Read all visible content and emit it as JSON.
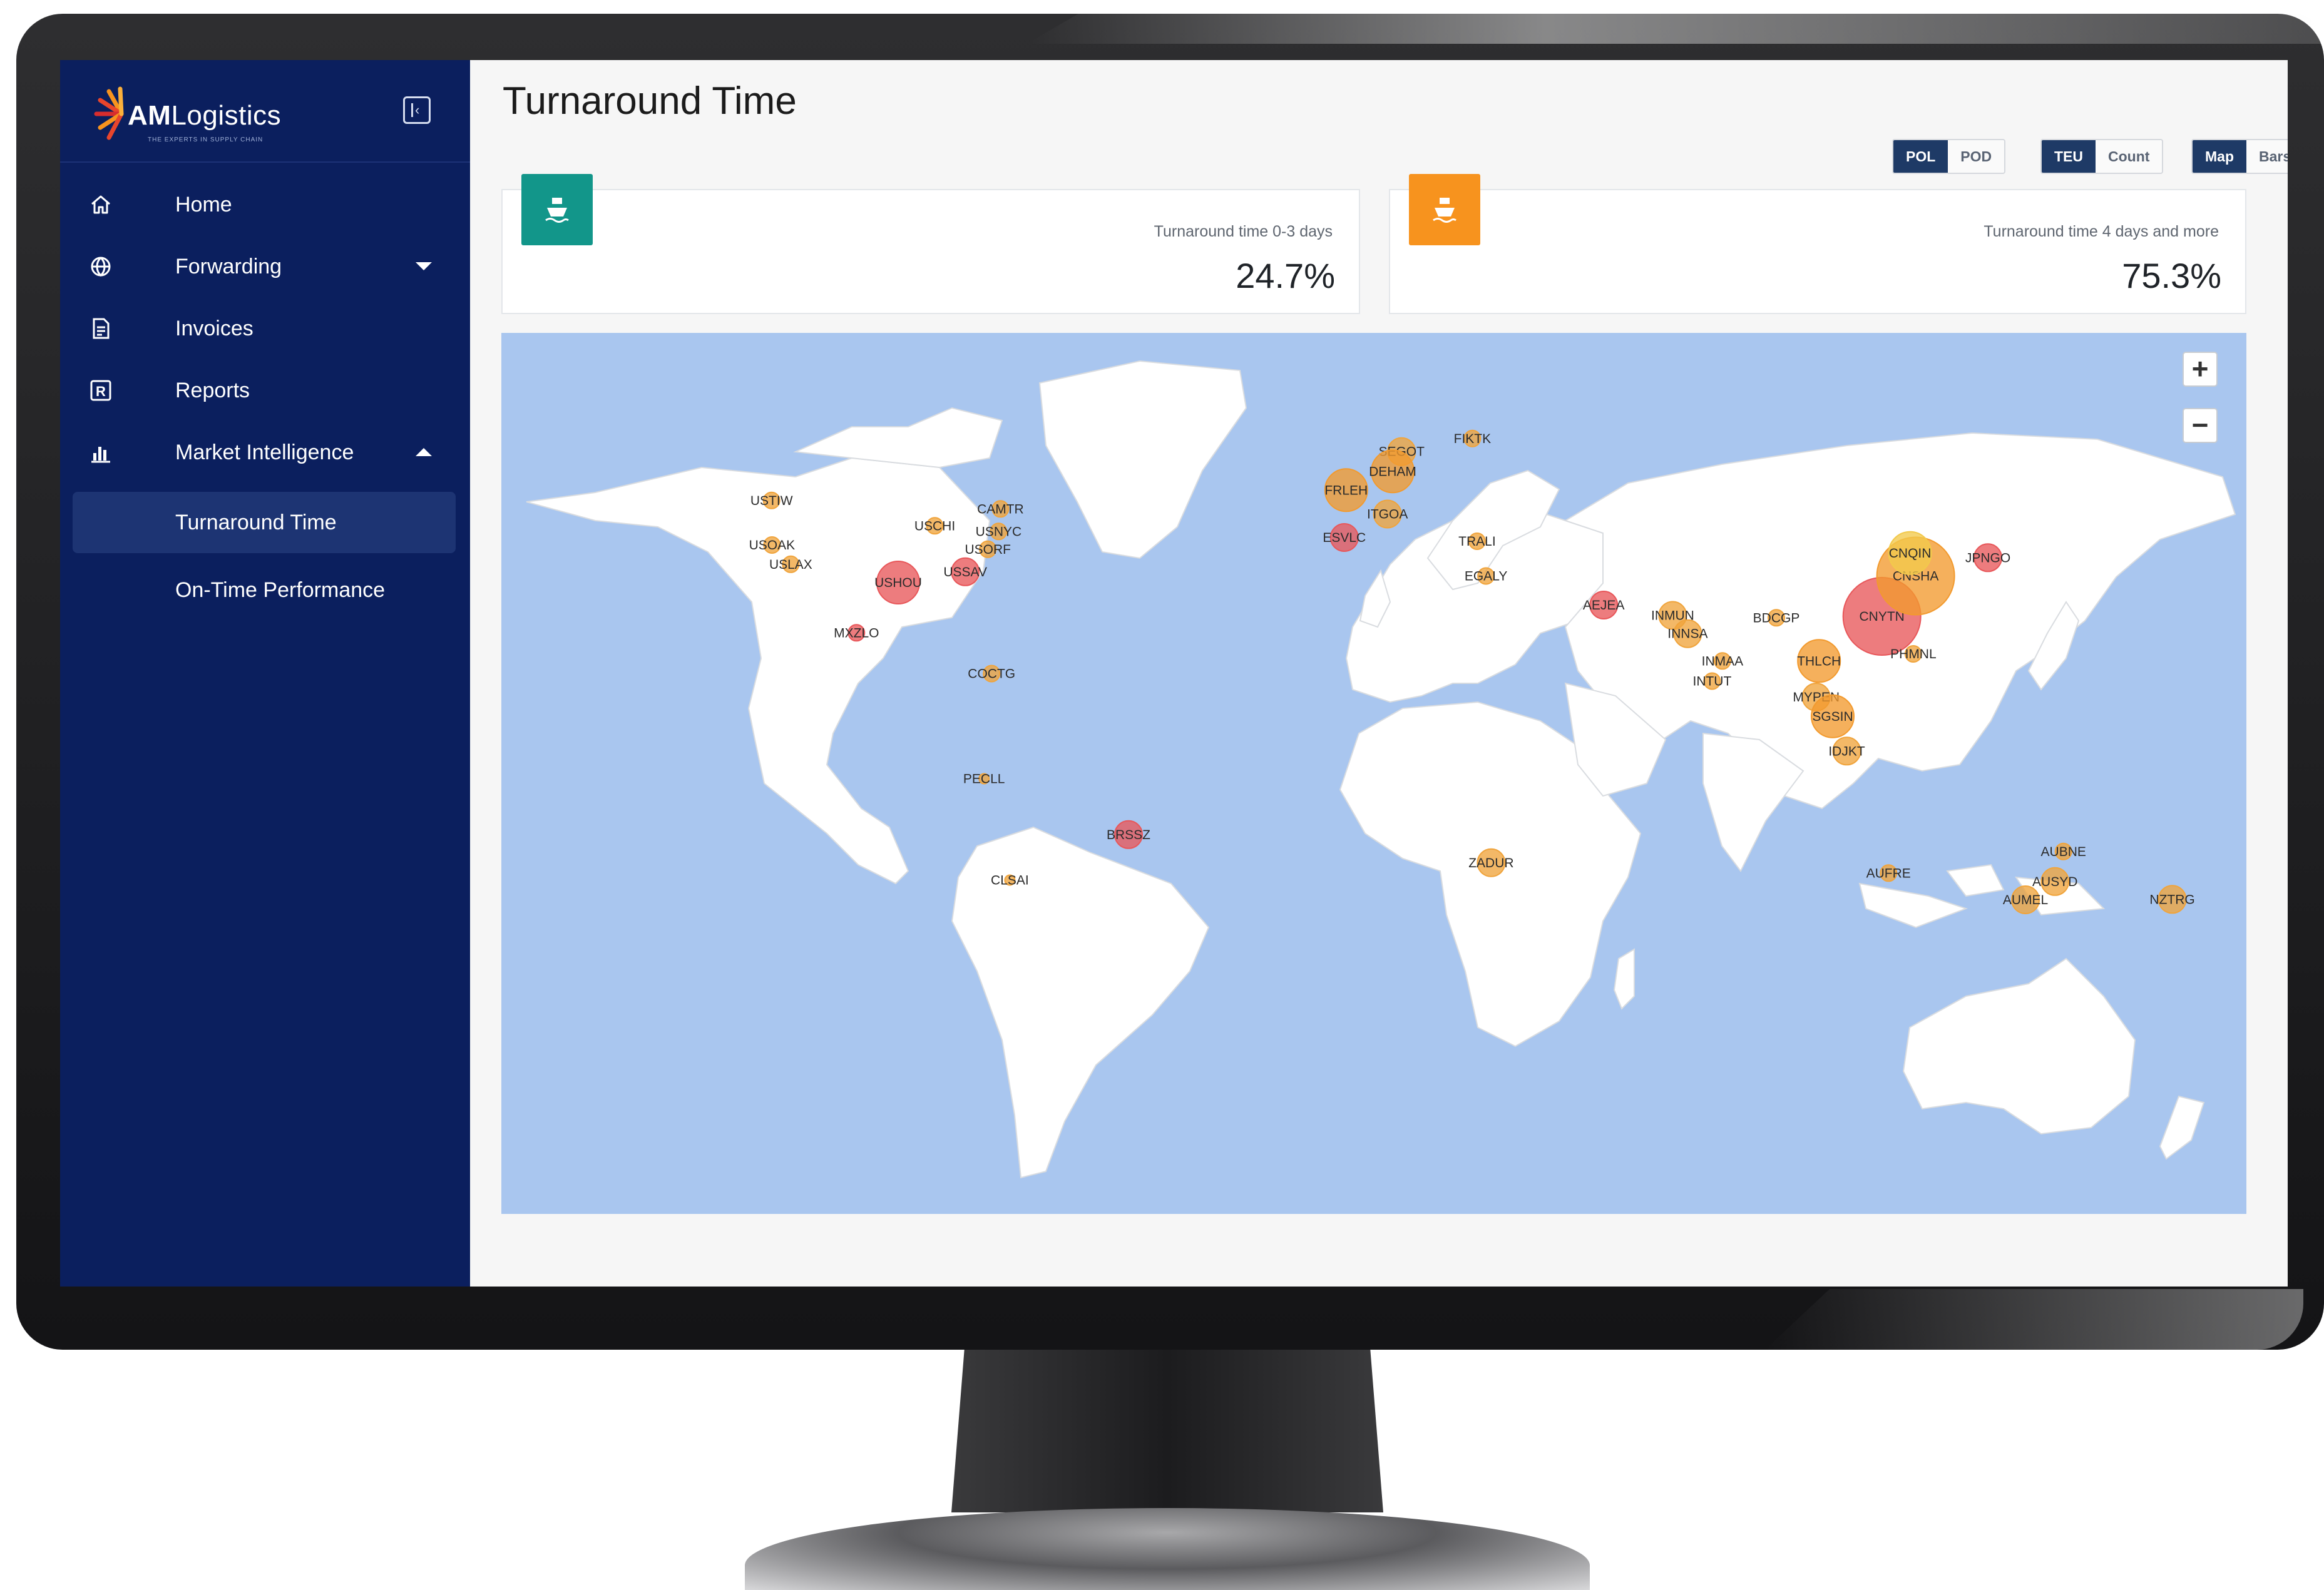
{
  "app": {
    "logo_text_bold": "AM",
    "logo_text_rest": "Logistics",
    "logo_tagline": "THE EXPERTS IN SUPPLY CHAIN"
  },
  "sidebar": {
    "items": [
      {
        "label": "Home",
        "icon": "home-icon"
      },
      {
        "label": "Forwarding",
        "icon": "globe-icon"
      },
      {
        "label": "Invoices",
        "icon": "invoice-icon"
      },
      {
        "label": "Reports",
        "icon": "reports-icon"
      },
      {
        "label": "Market Intelligence",
        "icon": "bar-chart-icon"
      }
    ],
    "subitems": [
      {
        "label": "Turnaround Time",
        "active": true
      },
      {
        "label": "On-Time Performance",
        "active": false
      }
    ]
  },
  "page": {
    "title": "Turnaround Time"
  },
  "toggles": {
    "port": {
      "options": [
        "POL",
        "POD"
      ],
      "selected": "POL"
    },
    "measure": {
      "options": [
        "TEU",
        "Count"
      ],
      "selected": "TEU"
    },
    "view": {
      "options": [
        "Map",
        "Bars"
      ],
      "selected": "Map"
    }
  },
  "cards": [
    {
      "label": "Turnaround time 0-3 days",
      "value": "24.7%",
      "icon": "ship-icon",
      "color": "#12968a"
    },
    {
      "label": "Turnaround time 4 days and more",
      "value": "75.3%",
      "icon": "ship-icon",
      "color": "#f7931e"
    }
  ],
  "map": {
    "zoom_in": "+",
    "zoom_out": "−",
    "ports": [
      {
        "code": "FIKTK",
        "lon": 27.0,
        "lat": 60.5,
        "color": "#f0a43c",
        "size": "s"
      },
      {
        "code": "SEGOT",
        "lon": 11.9,
        "lat": 57.7,
        "color": "#f0a43c",
        "size": "m"
      },
      {
        "code": "DEHAM",
        "lon": 10.0,
        "lat": 53.5,
        "color": "#f29a2e",
        "size": "l"
      },
      {
        "code": "FRLEH",
        "lon": 0.1,
        "lat": 49.5,
        "color": "#f29a2e",
        "size": "l"
      },
      {
        "code": "ITGOA",
        "lon": 8.9,
        "lat": 44.4,
        "color": "#f0a43c",
        "size": "m"
      },
      {
        "code": "ESVLC",
        "lon": -0.3,
        "lat": 39.4,
        "color": "#e8575a",
        "size": "m"
      },
      {
        "code": "TRALI",
        "lon": 28.0,
        "lat": 38.6,
        "color": "#f0a43c",
        "size": "s"
      },
      {
        "code": "EGALY",
        "lon": 29.9,
        "lat": 31.2,
        "color": "#f0a43c",
        "size": "s"
      },
      {
        "code": "AEJEA",
        "lon": 55.0,
        "lat": 25.0,
        "color": "#e8575a",
        "size": "m"
      },
      {
        "code": "INMUN",
        "lon": 69.7,
        "lat": 22.8,
        "color": "#f0a43c",
        "size": "m"
      },
      {
        "code": "INNSA",
        "lon": 72.9,
        "lat": 18.9,
        "color": "#f0a43c",
        "size": "m"
      },
      {
        "code": "INMAA",
        "lon": 80.3,
        "lat": 13.1,
        "color": "#f0a43c",
        "size": "s"
      },
      {
        "code": "INTUT",
        "lon": 78.1,
        "lat": 8.8,
        "color": "#f0a43c",
        "size": "s"
      },
      {
        "code": "BDCGP",
        "lon": 91.8,
        "lat": 22.3,
        "color": "#f0a43c",
        "size": "s"
      },
      {
        "code": "THLCH",
        "lon": 100.9,
        "lat": 13.1,
        "color": "#f29a2e",
        "size": "l"
      },
      {
        "code": "MYPEN",
        "lon": 100.3,
        "lat": 5.4,
        "color": "#f0a43c",
        "size": "m"
      },
      {
        "code": "SGSIN",
        "lon": 103.8,
        "lat": 1.3,
        "color": "#f29a2e",
        "size": "l"
      },
      {
        "code": "IDJKT",
        "lon": 106.8,
        "lat": -6.1,
        "color": "#f0a43c",
        "size": "m"
      },
      {
        "code": "CNYTN",
        "lon": 114.3,
        "lat": 22.6,
        "color": "#e8575a",
        "size": "xl"
      },
      {
        "code": "CNSHA",
        "lon": 121.5,
        "lat": 31.2,
        "color": "#f29a2e",
        "size": "xl"
      },
      {
        "code": "CNQIN",
        "lon": 120.3,
        "lat": 36.1,
        "color": "#f2c94c",
        "size": "l"
      },
      {
        "code": "PHMNL",
        "lon": 121.0,
        "lat": 14.6,
        "color": "#f0a43c",
        "size": "s"
      },
      {
        "code": "JPNGO",
        "lon": 136.9,
        "lat": 35.1,
        "color": "#e8575a",
        "size": "m"
      },
      {
        "code": "USTIW",
        "lon": -122.4,
        "lat": 47.3,
        "color": "#f0a43c",
        "size": "s"
      },
      {
        "code": "USOAK",
        "lon": -122.3,
        "lat": 37.8,
        "color": "#f0a43c",
        "size": "s"
      },
      {
        "code": "USLAX",
        "lon": -118.3,
        "lat": 33.7,
        "color": "#f0a43c",
        "size": "s"
      },
      {
        "code": "USCHI",
        "lon": -87.6,
        "lat": 41.9,
        "color": "#f0a43c",
        "size": "s"
      },
      {
        "code": "CAMTR",
        "lon": -73.6,
        "lat": 45.5,
        "color": "#f0a43c",
        "size": "s"
      },
      {
        "code": "USNYC",
        "lon": -74.0,
        "lat": 40.7,
        "color": "#f0a43c",
        "size": "s"
      },
      {
        "code": "USORF",
        "lon": -76.3,
        "lat": 36.9,
        "color": "#f0a43c",
        "size": "s"
      },
      {
        "code": "USSAV",
        "lon": -81.1,
        "lat": 32.1,
        "color": "#e8575a",
        "size": "m"
      },
      {
        "code": "USHOU",
        "lon": -95.4,
        "lat": 29.8,
        "color": "#e8575a",
        "size": "l"
      },
      {
        "code": "MXZLO",
        "lon": -104.3,
        "lat": 19.1,
        "color": "#e8575a",
        "size": "s"
      },
      {
        "code": "COCTG",
        "lon": -75.5,
        "lat": 10.4,
        "color": "#f0a43c",
        "size": "s"
      },
      {
        "code": "PECLL",
        "lon": -77.1,
        "lat": -12.0,
        "color": "#f0a43c",
        "size": "xs"
      },
      {
        "code": "BRSSZ",
        "lon": -46.3,
        "lat": -23.9,
        "color": "#e8575a",
        "size": "m"
      },
      {
        "code": "CLSAI",
        "lon": -71.6,
        "lat": -33.6,
        "color": "#f0a43c",
        "size": "xs"
      },
      {
        "code": "ZADUR",
        "lon": 31.0,
        "lat": -29.9,
        "color": "#f0a43c",
        "size": "m"
      },
      {
        "code": "AUFRE",
        "lon": 115.7,
        "lat": -32.1,
        "color": "#f0a43c",
        "size": "s"
      },
      {
        "code": "AUBNE",
        "lon": 153.0,
        "lat": -27.5,
        "color": "#f0a43c",
        "size": "s"
      },
      {
        "code": "AUSYD",
        "lon": 151.2,
        "lat": -33.9,
        "color": "#f0a43c",
        "size": "m"
      },
      {
        "code": "AUMEL",
        "lon": 144.9,
        "lat": -37.8,
        "color": "#f0a43c",
        "size": "m"
      },
      {
        "code": "NZTRG",
        "lon": 176.2,
        "lat": -37.7,
        "color": "#f0a43c",
        "size": "m"
      }
    ]
  }
}
